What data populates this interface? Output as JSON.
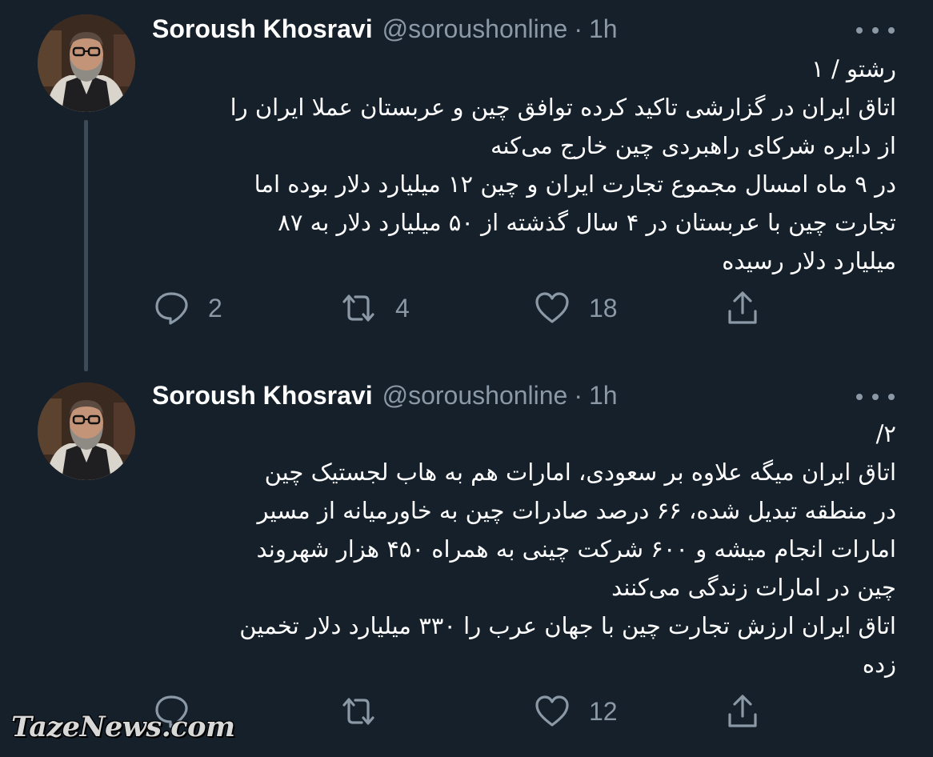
{
  "colors": {
    "background": "#15202b",
    "text_primary": "#ffffff",
    "text_secondary": "#8b98a5",
    "thread_line": "#3d4a57"
  },
  "tweets": [
    {
      "author_name": "Soroush Khosravi",
      "author_handle": "@soroushonline",
      "separator": "·",
      "timestamp": "1h",
      "body_lines": [
        "رشتو / ۱",
        "اتاق ایران در گزارشی تاکید کرده توافق چین و عربستان عملا ایران را",
        "از دایره شرکای راهبردی چین خارج می‌کنه",
        "در ۹ ماه امسال مجموع تجارت ایران و چین ۱۲ میلیارد دلار بوده اما",
        "تجارت چین با عربستان در ۴ سال گذشته از ۵۰ میلیارد دلار به ۸۷",
        "میلیارد دلار رسیده"
      ],
      "reply_count": "2",
      "retweet_count": "4",
      "like_count": "18"
    },
    {
      "author_name": "Soroush Khosravi",
      "author_handle": "@soroushonline",
      "separator": "·",
      "timestamp": "1h",
      "body_lines": [
        "۲/",
        "اتاق ایران میگه علاوه بر سعودی، امارات هم به هاب لجستیک چین",
        "در منطقه تبدیل شده، ۶۶ درصد صادرات چین به خاورمیانه از مسیر",
        "امارات انجام میشه و ۶۰۰ شرکت چینی به همراه ۴۵۰ هزار شهروند",
        "چین در امارات زندگی می‌کنند",
        "اتاق ایران ارزش تجارت چین با جهان عرب را ۳۳۰ میلیارد دلار تخمین",
        "زده"
      ],
      "reply_count": "",
      "retweet_count": "",
      "like_count": "12"
    }
  ],
  "icons": {
    "reply": "reply-icon",
    "retweet": "retweet-icon",
    "like": "heart-icon",
    "share": "share-icon",
    "more": "more-icon"
  },
  "watermark": "TazeNews.com"
}
